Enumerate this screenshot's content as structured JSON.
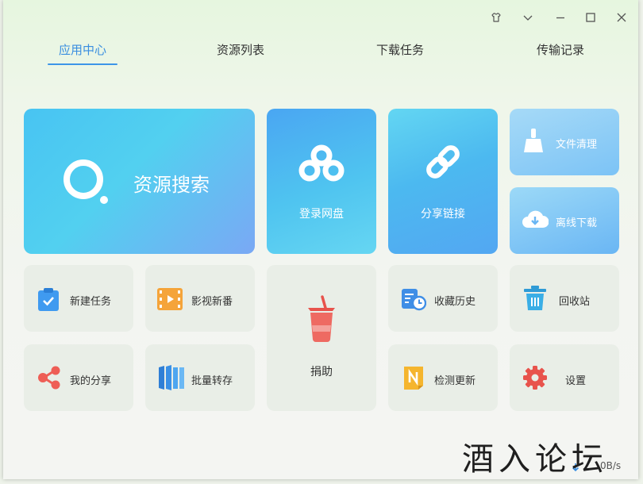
{
  "tabs": [
    {
      "label": "应用中心",
      "active": true
    },
    {
      "label": "资源列表",
      "active": false
    },
    {
      "label": "下载任务",
      "active": false
    },
    {
      "label": "传输记录",
      "active": false
    }
  ],
  "tiles": {
    "search": "资源搜索",
    "login": "登录网盘",
    "share_link": "分享链接",
    "clean": "文件清理",
    "offline": "离线下载",
    "new_task": "新建任务",
    "movies": "影视新番",
    "donate": "捐助",
    "history": "收藏历史",
    "recycle": "回收站",
    "my_share": "我的分享",
    "batch": "批量转存",
    "update": "检测更新",
    "settings": "设置"
  },
  "status": {
    "speed": "0B/s"
  },
  "watermark": "酒入论坛",
  "colors": {
    "accent": "#3d95e8",
    "tile_light": "#e9eee7",
    "red_icon": "#e8534c",
    "blue_icon": "#3f8ee6"
  }
}
